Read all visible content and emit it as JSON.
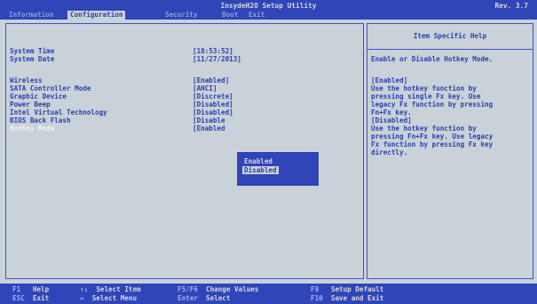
{
  "header": {
    "title": "InsydeH2O Setup Utility",
    "revision": "Rev. 3.7",
    "tabs": [
      {
        "label": "Information"
      },
      {
        "label": "Configuration"
      },
      {
        "label": "Security"
      },
      {
        "label": "Boot"
      },
      {
        "label": "Exit"
      }
    ]
  },
  "settings": [
    {
      "label": "System Time",
      "value": "[18:53:52]"
    },
    {
      "label": "System Date",
      "value": "[11/27/2013]"
    },
    {
      "label": "Wireless",
      "value": "[Enabled]"
    },
    {
      "label": "SATA Controller Mode",
      "value": "[AHCI]"
    },
    {
      "label": "Graphic Device",
      "value": "[Discrete]"
    },
    {
      "label": "Power Beep",
      "value": "[Disabled]"
    },
    {
      "label": "Intel Virtual Technology",
      "value": "[Disabled]"
    },
    {
      "label": "BIOS Back Flash",
      "value": "[Disable"
    },
    {
      "label": "HotKey Mode",
      "value": "[Enabled"
    }
  ],
  "popup": {
    "options": [
      "Enabled",
      "Disabled"
    ],
    "selected_index": 1
  },
  "help": {
    "title": "Item Specific Help",
    "lines": [
      "Enable or Disable Hotkey Mode.",
      "",
      "[Enabled]",
      "Use the hotkey function by",
      "pressing single Fx key. Use",
      "legacy Fx function by pressing",
      "Fn+Fx key.",
      "[Disabled]",
      "Use the hotkey function by",
      "pressing Fn+Fx key. Use legacy",
      "Fx function by pressing Fx key",
      "directly."
    ]
  },
  "footer": {
    "row1": [
      {
        "key": "F1",
        "label": "Help"
      },
      {
        "key": "↑↓",
        "label": "Select Item"
      },
      {
        "key": "F5/F6",
        "label": "Change Values"
      },
      {
        "key": "F9",
        "label": "Setup Default"
      }
    ],
    "row2": [
      {
        "key": "ESC",
        "label": "Exit"
      },
      {
        "key": "↔",
        "label": "Select Menu"
      },
      {
        "key": "Enter",
        "label": "Select"
      },
      {
        "key": "F10",
        "label": "Save and Exit"
      }
    ]
  },
  "colors": {
    "bar_blue": "#2f45b8",
    "panel_bg": "#c9d1d9",
    "text_blue": "#2a3fae",
    "highlight": "#f2f2f2"
  }
}
